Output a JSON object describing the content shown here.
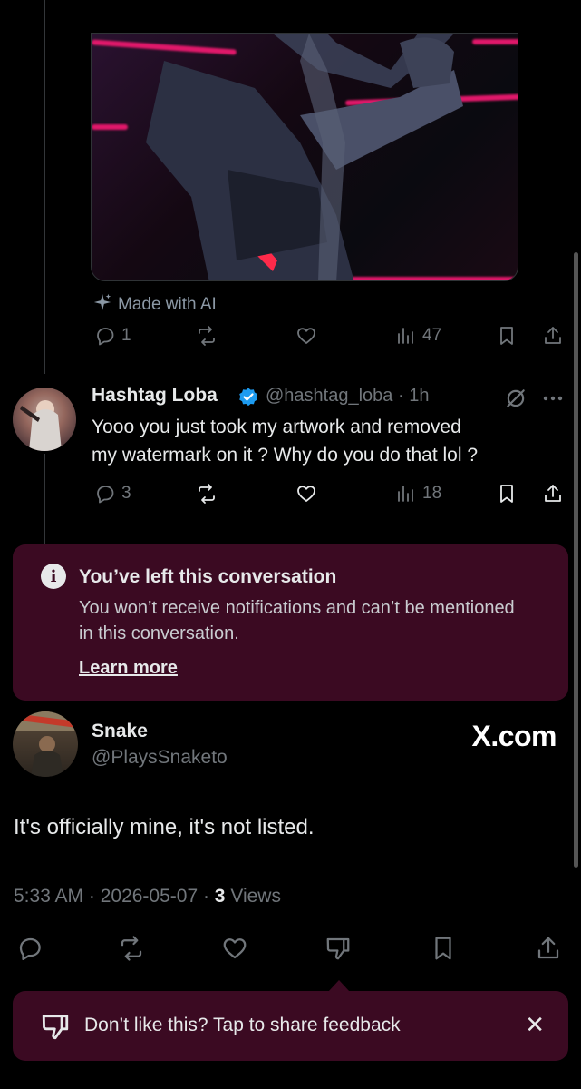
{
  "parent_tweet": {
    "media_alt_icon": "artwork-image",
    "ai_label": "Made with AI",
    "actions": {
      "replies": "1",
      "views": "47"
    }
  },
  "reply_tweet": {
    "name": "Hashtag Loba",
    "handle": "@hashtag_loba",
    "time": "· 1h",
    "text_line1": "Yooo you just took my artwork and removed",
    "text_line2": "my watermark on it ? Why do you do that lol ?",
    "actions": {
      "replies": "3",
      "views": "18"
    }
  },
  "notice": {
    "title": "You’ve left this conversation",
    "body": "You won’t receive notifications and can’t be mentioned in this conversation.",
    "link": "Learn more"
  },
  "main_tweet": {
    "name": "Snake",
    "handle": "@PlaysSnaketo",
    "text": "It's officially mine, it's not listed.",
    "time": "5:33 AM · 2026-05-07 · ",
    "views_count": "3",
    "views_label": " Views"
  },
  "watermark": "X.com",
  "toast": {
    "text": "Don’t like this? Tap to share feedback",
    "close": "✕"
  },
  "colors": {
    "background": "#000000",
    "accent_panel": "#3b0a22",
    "muted": "#71767b",
    "verified": "#1d9bf0",
    "neon": "#e0186a"
  }
}
